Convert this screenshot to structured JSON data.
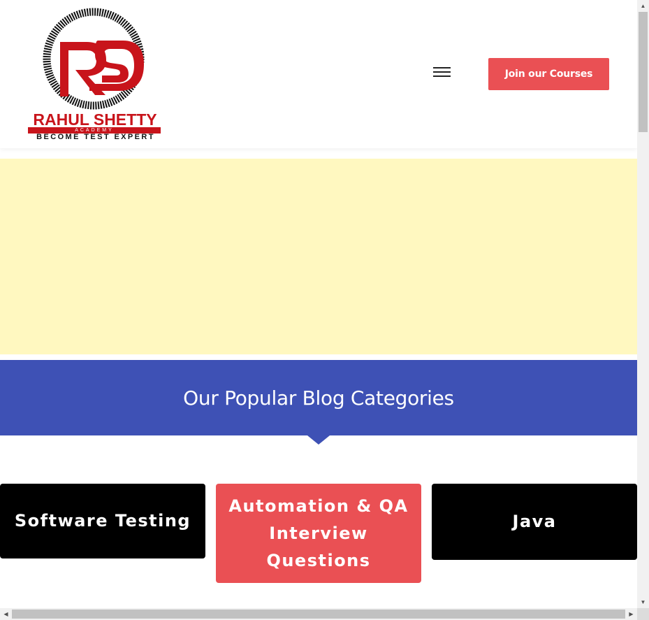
{
  "header": {
    "logo": {
      "name": "RAHUL SHETTY",
      "subtitle": "ACADEMY",
      "tagline": "BECOME TEST EXPERT",
      "monogram": "RS"
    },
    "menu_icon": "hamburger-menu-icon",
    "join_button_label": "Join our Courses"
  },
  "categories": {
    "heading": "Our Popular Blog Categories",
    "cards": [
      {
        "label": "Software Testing"
      },
      {
        "label": "Automation & QA Interview Questions"
      },
      {
        "label": "Java"
      }
    ]
  },
  "colors": {
    "brand_red": "#c8141b",
    "button_coral": "#ea5054",
    "band_blue": "#3e51b5",
    "ad_yellow": "#fff8c0",
    "card_black": "#000000"
  },
  "scrollbars": {
    "up_icon": "triangle-up-icon",
    "down_icon": "triangle-down-icon",
    "left_icon": "triangle-left-icon",
    "right_icon": "triangle-right-icon"
  }
}
